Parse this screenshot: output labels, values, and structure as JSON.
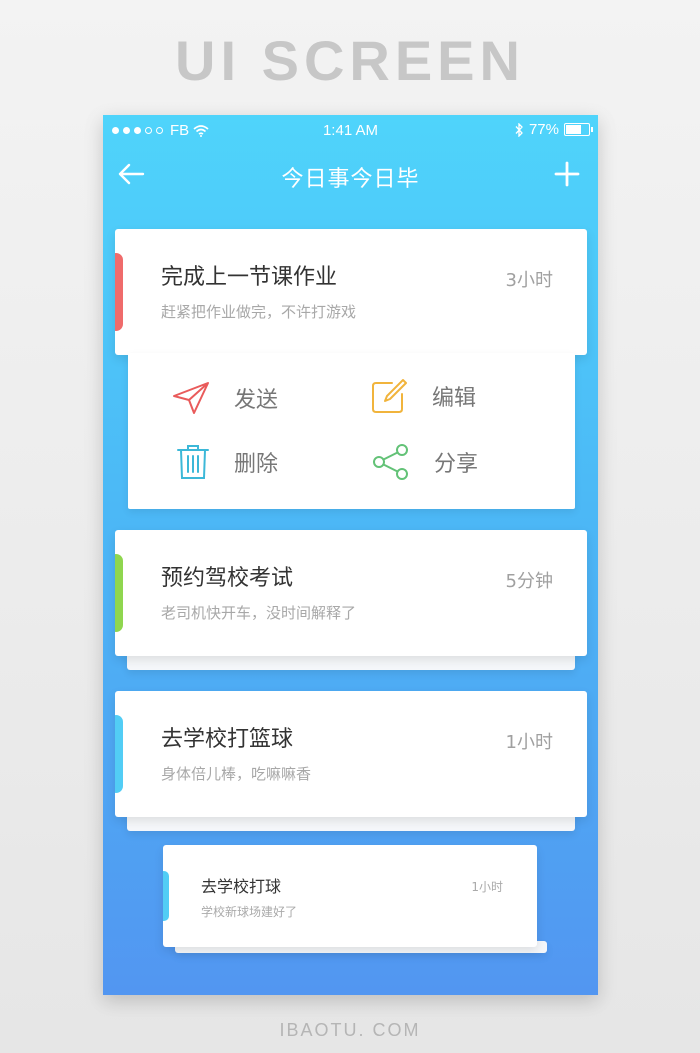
{
  "page_heading": "UI SCREEN",
  "footer_text": "IBAOTU. COM",
  "status_bar": {
    "carrier": "FB",
    "time": "1:41 AM",
    "battery": "77%",
    "battery_level": 0.77
  },
  "nav": {
    "title": "今日事今日毕",
    "back_icon": "arrow-left-icon",
    "add_icon": "plus-icon"
  },
  "tasks": [
    {
      "title": "完成上一节课作业",
      "desc": "赶紧把作业做完，不许打游戏",
      "duration": "3小时",
      "accent": "#ef6b6b"
    },
    {
      "title": "预约驾校考试",
      "desc": "老司机快开车，没时间解释了",
      "duration": "5分钟",
      "accent": "#8fd64f"
    },
    {
      "title": "去学校打篮球",
      "desc": "身体倍儿棒，吃嘛嘛香",
      "duration": "1小时",
      "accent": "#52cdf5"
    },
    {
      "title": "去学校打球",
      "desc": "学校新球场建好了",
      "duration": "1小时",
      "accent": "#52cdf5"
    }
  ],
  "actions": {
    "send": {
      "label": "发送",
      "icon": "send-icon",
      "color": "#e95b5b"
    },
    "edit": {
      "label": "编辑",
      "icon": "edit-icon",
      "color": "#f1b43c"
    },
    "delete": {
      "label": "删除",
      "icon": "trash-icon",
      "color": "#3cb8d8"
    },
    "share": {
      "label": "分享",
      "icon": "share-icon",
      "color": "#63c277"
    }
  }
}
